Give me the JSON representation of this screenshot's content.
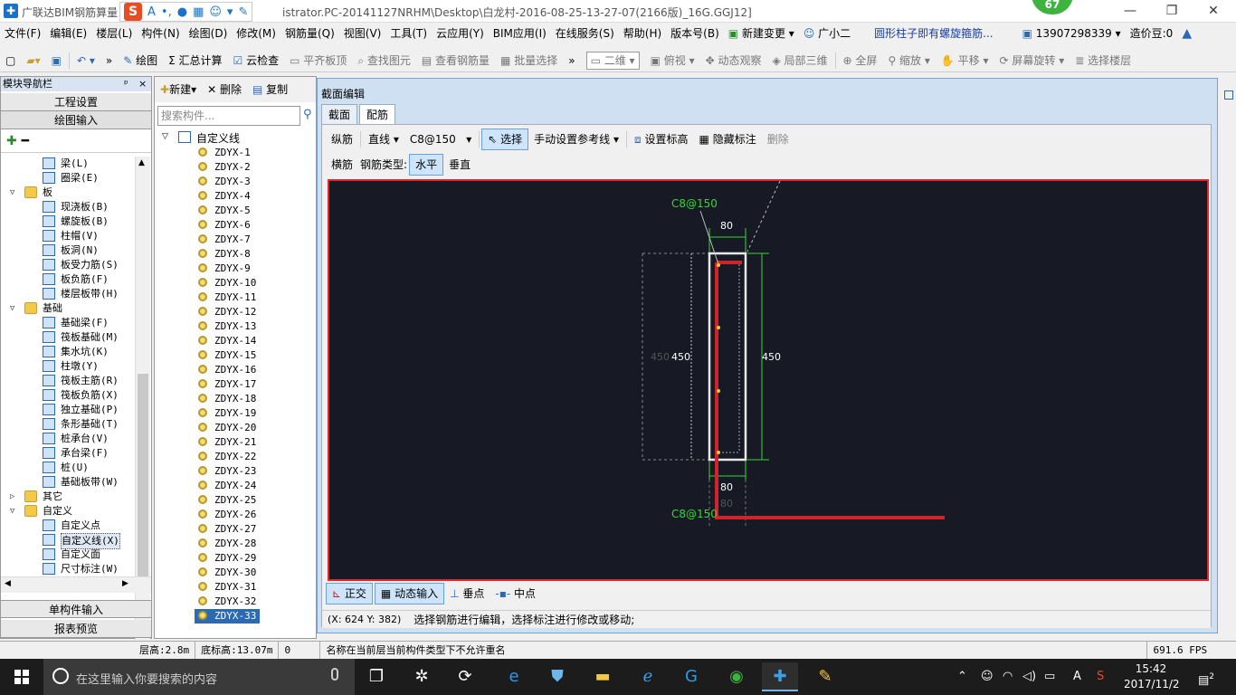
{
  "window": {
    "title": "广联达BIM钢筋算量",
    "title_path": "istrator.PC-20141127NRHM\\Desktop\\白龙村-2016-08-25-13-27-07(2166版)_16G.GGJ12]",
    "badge": "67"
  },
  "menu": [
    "文件(F)",
    "编辑(E)",
    "楼层(L)",
    "构件(N)",
    "绘图(D)",
    "修改(M)",
    "钢筋量(Q)",
    "视图(V)",
    "工具(T)",
    "云应用(Y)",
    "BIM应用(I)",
    "在线服务(S)",
    "帮助(H)",
    "版本号(B)"
  ],
  "menu_extra": {
    "new_change": "新建变更",
    "assistant": "广小二",
    "news": "圆形柱子即有螺旋箍筋...",
    "phone": "13907298339",
    "credit": "造价豆:0"
  },
  "toolbar": {
    "draw": "绘图",
    "summary": "汇总计算",
    "cloud_check": "云检查",
    "align_top": "平齐板顶",
    "find_elem": "查找图元",
    "view_rebar": "查看钢筋量",
    "batch_select": "批量选择",
    "view_mode": "二维",
    "top_view": "俯视",
    "dynamic_view": "动态观察",
    "local_3d": "局部三维",
    "full_screen": "全屏",
    "zoom": "缩放",
    "pan": "平移",
    "rotate": "屏幕旋转",
    "select_floor": "选择楼层"
  },
  "leftnav": {
    "header": "模块导航栏",
    "pin": "ᵖ",
    "close": "×",
    "project_settings": "工程设置",
    "drawing_input": "绘图输入",
    "single_input": "单构件输入",
    "report_preview": "报表预览",
    "tree": [
      {
        "label": "梁(L)",
        "level": 2
      },
      {
        "label": "圈梁(E)",
        "level": 2
      },
      {
        "label": "板",
        "level": 1,
        "folder": true
      },
      {
        "label": "现浇板(B)",
        "level": 2
      },
      {
        "label": "螺旋板(B)",
        "level": 2
      },
      {
        "label": "柱帽(V)",
        "level": 2
      },
      {
        "label": "板洞(N)",
        "level": 2
      },
      {
        "label": "板受力筋(S)",
        "level": 2
      },
      {
        "label": "板负筋(F)",
        "level": 2
      },
      {
        "label": "楼层板带(H)",
        "level": 2
      },
      {
        "label": "基础",
        "level": 1,
        "folder": true
      },
      {
        "label": "基础梁(F)",
        "level": 2
      },
      {
        "label": "筏板基础(M)",
        "level": 2
      },
      {
        "label": "集水坑(K)",
        "level": 2
      },
      {
        "label": "柱墩(Y)",
        "level": 2
      },
      {
        "label": "筏板主筋(R)",
        "level": 2
      },
      {
        "label": "筏板负筋(X)",
        "level": 2
      },
      {
        "label": "独立基础(P)",
        "level": 2
      },
      {
        "label": "条形基础(T)",
        "level": 2
      },
      {
        "label": "桩承台(V)",
        "level": 2
      },
      {
        "label": "承台梁(F)",
        "level": 2
      },
      {
        "label": "桩(U)",
        "level": 2
      },
      {
        "label": "基础板带(W)",
        "level": 2
      },
      {
        "label": "其它",
        "level": 1,
        "folder": true,
        "collapsed": true
      },
      {
        "label": "自定义",
        "level": 1,
        "folder": true
      },
      {
        "label": "自定义点",
        "level": 2
      },
      {
        "label": "自定义线(X)",
        "level": 2,
        "selected": true
      },
      {
        "label": "自定义面",
        "level": 2
      },
      {
        "label": "尺寸标注(W)",
        "level": 2
      }
    ]
  },
  "complist": {
    "new": "新建",
    "delete": "删除",
    "copy": "复制",
    "search_placeholder": "搜索构件...",
    "root": "自定义线",
    "items": [
      "ZDYX-1",
      "ZDYX-2",
      "ZDYX-3",
      "ZDYX-4",
      "ZDYX-5",
      "ZDYX-6",
      "ZDYX-7",
      "ZDYX-8",
      "ZDYX-9",
      "ZDYX-10",
      "ZDYX-11",
      "ZDYX-12",
      "ZDYX-13",
      "ZDYX-14",
      "ZDYX-15",
      "ZDYX-16",
      "ZDYX-17",
      "ZDYX-18",
      "ZDYX-19",
      "ZDYX-20",
      "ZDYX-21",
      "ZDYX-22",
      "ZDYX-23",
      "ZDYX-24",
      "ZDYX-25",
      "ZDYX-26",
      "ZDYX-27",
      "ZDYX-28",
      "ZDYX-29",
      "ZDYX-30",
      "ZDYX-31",
      "ZDYX-32",
      "ZDYX-33"
    ],
    "selected_index": 32
  },
  "dialog": {
    "title": "截面编辑",
    "tabs": [
      "截面",
      "配筋"
    ],
    "active_tab": 1,
    "row1": {
      "longitudinal": "纵筋",
      "line_type": "直线",
      "spec": "C8@150",
      "select": "选择",
      "manual_ref": "手动设置参考线",
      "set_elevation": "设置标高",
      "hide_label": "隐藏标注",
      "delete": "删除"
    },
    "row2": {
      "transverse": "横筋",
      "rebar_type": "钢筋类型:",
      "horizontal": "水平",
      "vertical": "垂直"
    },
    "canvas": {
      "label_top": "C8@150",
      "label_bottom": "C8@150",
      "dim_top": "80",
      "dim_bottom": "80",
      "dim_bottom_ghost": "80",
      "dim_left": "450",
      "dim_left_ghost": "450",
      "dim_right": "450"
    },
    "bottom": {
      "ortho": "正交",
      "dynamic_input": "动态输入",
      "perpendicular": "垂点",
      "midpoint": "中点"
    },
    "status": {
      "coords": "(X: 624 Y: 382)",
      "hint": "选择钢筋进行编辑，选择标注进行修改或移动;"
    }
  },
  "appstatus": {
    "floor_height": "层高:2.8m",
    "base_elev": "底标高:13.07m",
    "zero": "0",
    "message": "名称在当前层当前构件类型下不允许重名",
    "fps": "691.6 FPS"
  },
  "taskbar": {
    "search_placeholder": "在这里输入你要搜索的内容",
    "time": "15:42",
    "date": "2017/11/2",
    "ime_letter": "A",
    "notif_count": "2"
  },
  "colors": {
    "canvas_bg": "#171a25",
    "rebar_red": "#d0232b",
    "dim_green": "#33d633",
    "accent_blue": "#2b69b3"
  }
}
